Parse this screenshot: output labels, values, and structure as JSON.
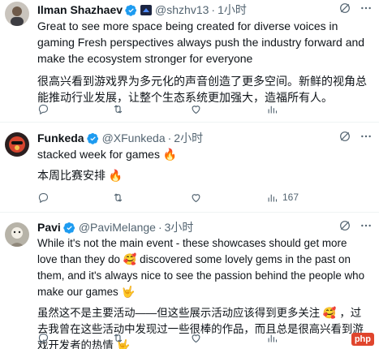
{
  "tweets": [
    {
      "name": "Ilman Shazhaev",
      "handle": "@shzhv13",
      "separator": "·",
      "time": "1小时",
      "text_en": "Great to see more space being created for diverse voices in gaming Fresh perspectives always push the industry forward and make the ecosystem stronger for everyone",
      "text_zh": "很高兴看到游戏界为多元化的声音创造了更多空间。新鲜的视角总能推动行业发展，让整个生态系统更加强大，造福所有人。",
      "views": ""
    },
    {
      "name": "Funkeda",
      "handle": "@XFunkeda",
      "separator": "·",
      "time": "2小时",
      "text_en": "stacked week for games",
      "emoji_en": "🔥",
      "text_zh": "本周比赛安排",
      "emoji_zh": "🔥",
      "views": "167"
    },
    {
      "name": "Pavi",
      "handle": "@PaviMelange",
      "separator": "·",
      "time": "3小时",
      "text_en_1": "While it's not the main event - these showcases should get more love than they do",
      "emoji_1": "🥰",
      "text_en_2": "discovered some lovely gems in the past on them, and it's always nice to see the passion behind the people who make our games",
      "emoji_2": "🤟",
      "text_zh_1": "虽然这不是主要活动——但这些展示活动应该得到更多关注",
      "emoji_3": "🥰",
      "text_zh_2": "，过去我曾在这些活动中发现过一些很棒的作品，而且总是很高兴看到游戏开发者的热情",
      "emoji_4": "🤟"
    }
  ],
  "watermark": "php",
  "icons": [
    "verified-badge-icon",
    "grok-icon",
    "more-icon",
    "reply-icon",
    "retweet-icon",
    "like-icon",
    "views-icon"
  ],
  "colors": {
    "accent": "#1d9bf0",
    "muted": "#536471",
    "text": "#0f1419",
    "divider": "#eff3f4",
    "fire": "#f4900c"
  }
}
